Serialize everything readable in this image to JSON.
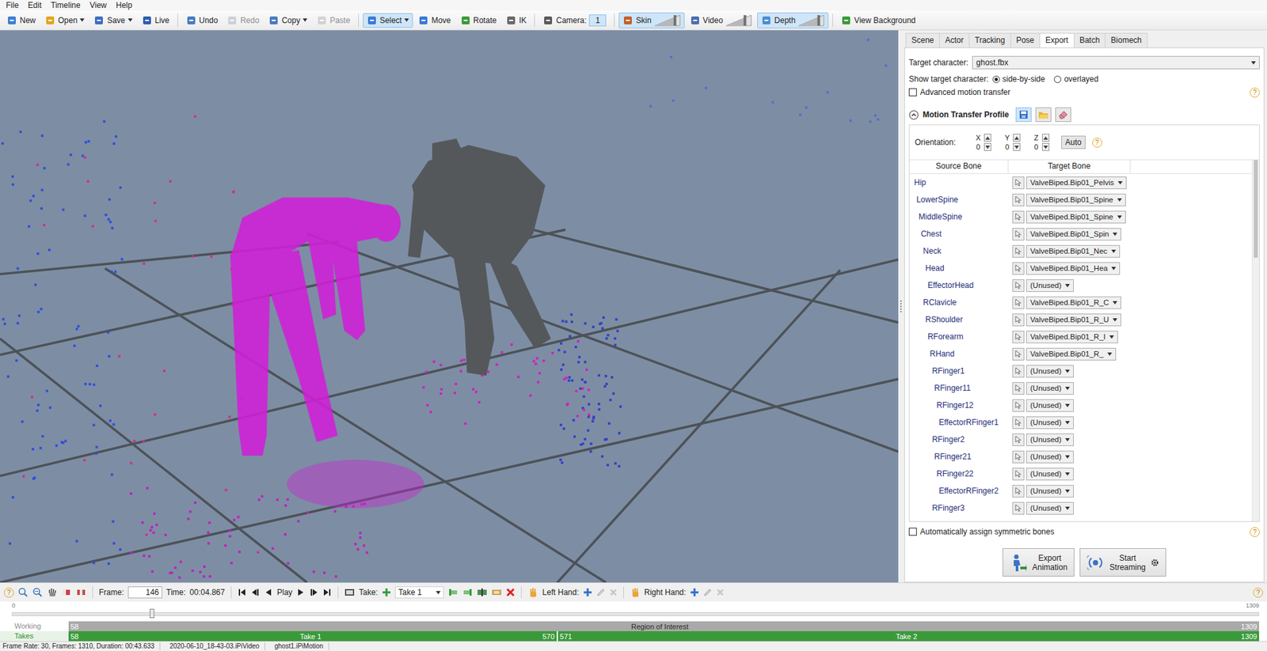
{
  "menu": [
    "File",
    "Edit",
    "Timeline",
    "View",
    "Help"
  ],
  "toolbar": {
    "groups": [
      [
        {
          "label": "New",
          "kind": "button",
          "selected": false,
          "disabled": false
        },
        {
          "label": "Open",
          "kind": "dropdown",
          "selected": false,
          "disabled": false
        },
        {
          "label": "Save",
          "kind": "dropdown",
          "selected": false,
          "disabled": false
        },
        {
          "label": "Live",
          "kind": "button",
          "selected": false,
          "disabled": false
        }
      ],
      [
        {
          "label": "Undo",
          "kind": "button",
          "selected": false,
          "disabled": false
        },
        {
          "label": "Redo",
          "kind": "button",
          "selected": false,
          "disabled": true
        },
        {
          "label": "Copy",
          "kind": "dropdown",
          "selected": false,
          "disabled": false
        },
        {
          "label": "Paste",
          "kind": "button",
          "selected": false,
          "disabled": true
        }
      ],
      [
        {
          "label": "Select",
          "kind": "dropdown",
          "selected": true,
          "disabled": false
        },
        {
          "label": "Move",
          "kind": "button",
          "selected": false,
          "disabled": false
        },
        {
          "label": "Rotate",
          "kind": "button",
          "selected": false,
          "disabled": false
        },
        {
          "label": "IK",
          "kind": "button",
          "selected": false,
          "disabled": false
        }
      ],
      [
        {
          "label": "Camera:",
          "kind": "field",
          "value": "1",
          "selected": false,
          "disabled": false
        }
      ],
      [
        {
          "label": "Skin",
          "kind": "slider",
          "selected": true,
          "disabled": false,
          "level": 0.8
        },
        {
          "label": "Video",
          "kind": "slider",
          "selected": false,
          "disabled": false,
          "level": 0.75
        },
        {
          "label": "Depth",
          "kind": "slider",
          "selected": true,
          "disabled": false,
          "level": 0.8
        }
      ],
      [
        {
          "label": "View Background",
          "kind": "button",
          "selected": false,
          "disabled": false
        }
      ]
    ]
  },
  "panel": {
    "tabs": [
      {
        "label": "Scene",
        "selected": false
      },
      {
        "label": "Actor",
        "selected": false
      },
      {
        "label": "Tracking",
        "selected": false
      },
      {
        "label": "Pose",
        "selected": false
      },
      {
        "label": "Export",
        "selected": true
      },
      {
        "label": "Batch",
        "selected": false
      },
      {
        "label": "Biomech",
        "selected": false
      }
    ],
    "help": "?",
    "target_character": {
      "label": "Target character:",
      "value": "ghost.fbx"
    },
    "show_target": {
      "label": "Show target character:",
      "options": [
        {
          "label": "side-by-side",
          "selected": true
        },
        {
          "label": "overlayed",
          "selected": false
        }
      ]
    },
    "advanced_transfer": {
      "label": "Advanced motion transfer",
      "checked": false
    },
    "profile": {
      "title": "Motion Transfer Profile",
      "expanded": true
    },
    "orientation": {
      "label": "Orientation:",
      "axes": [
        {
          "axis": "X",
          "value": "0"
        },
        {
          "axis": "Y",
          "value": "0"
        },
        {
          "axis": "Z",
          "value": "0"
        }
      ],
      "button": "Auto"
    },
    "bones": {
      "columns": [
        "Source Bone",
        "Target Bone"
      ],
      "scrollbar": {
        "position": 0,
        "share": 0.27
      },
      "rows": [
        {
          "source": "Hip",
          "depth": 0,
          "target": "ValveBiped.Bip01_Pelvis"
        },
        {
          "source": "LowerSpine",
          "depth": 1,
          "target": "ValveBiped.Bip01_Spine"
        },
        {
          "source": "MiddleSpine",
          "depth": 2,
          "target": "ValveBiped.Bip01_Spine"
        },
        {
          "source": "Chest",
          "depth": 3,
          "target": "ValveBiped.Bip01_Spin"
        },
        {
          "source": "Neck",
          "depth": 4,
          "target": "ValveBiped.Bip01_Nec"
        },
        {
          "source": "Head",
          "depth": 5,
          "target": "ValveBiped.Bip01_Hea"
        },
        {
          "source": "EffectorHead",
          "depth": 6,
          "target": "(Unused)"
        },
        {
          "source": "RClavicle",
          "depth": 4,
          "target": "ValveBiped.Bip01_R_C"
        },
        {
          "source": "RShoulder",
          "depth": 5,
          "target": "ValveBiped.Bip01_R_U"
        },
        {
          "source": "RForearm",
          "depth": 6,
          "target": "ValveBiped.Bip01_R_I"
        },
        {
          "source": "RHand",
          "depth": 7,
          "target": "ValveBiped.Bip01_R_"
        },
        {
          "source": "RFinger1",
          "depth": 8,
          "target": "(Unused)"
        },
        {
          "source": "RFinger11",
          "depth": 9,
          "target": "(Unused)"
        },
        {
          "source": "RFinger12",
          "depth": 10,
          "target": "(Unused)"
        },
        {
          "source": "EffectorRFinger1",
          "depth": 11,
          "target": "(Unused)"
        },
        {
          "source": "RFinger2",
          "depth": 8,
          "target": "(Unused)"
        },
        {
          "source": "RFinger21",
          "depth": 9,
          "target": "(Unused)"
        },
        {
          "source": "RFinger22",
          "depth": 10,
          "target": "(Unused)"
        },
        {
          "source": "EffectorRFinger2",
          "depth": 11,
          "target": "(Unused)"
        },
        {
          "source": "RFinger3",
          "depth": 8,
          "target": "(Unused)"
        }
      ]
    },
    "auto_symmetric": {
      "label": "Automatically assign symmetric bones",
      "checked": false
    },
    "actions": [
      {
        "lines": [
          "Export",
          "Animation"
        ],
        "kind": "export"
      },
      {
        "lines": [
          "Start",
          "Streaming"
        ],
        "kind": "stream"
      }
    ]
  },
  "bottom_bar": {
    "help": "?",
    "frame": {
      "label": "Frame:",
      "value": "146"
    },
    "time": {
      "label": "Time:",
      "value": "00:04.867"
    },
    "play": "Play",
    "take": {
      "label": "Take:",
      "value": "Take 1"
    },
    "hands": [
      {
        "label": "Left Hand:"
      },
      {
        "label": "Right Hand:"
      }
    ]
  },
  "timeline": {
    "min": "0",
    "max": "1309",
    "level": 0.1115
  },
  "working": {
    "label": "Working",
    "start": "58",
    "title": "Region of Interest",
    "end": "1309"
  },
  "takes": {
    "label": "Takes",
    "items": [
      {
        "name": "Take 1",
        "start": "58",
        "end": "570"
      },
      {
        "name": "Take 2",
        "start": "571",
        "end": "1309"
      }
    ]
  },
  "status": [
    "Frame Rate: 30, Frames: 1310, Duration: 00:43.633",
    "2020-06-10_18-43-03.iPiVideo",
    "ghost1.iPiMotion"
  ]
}
